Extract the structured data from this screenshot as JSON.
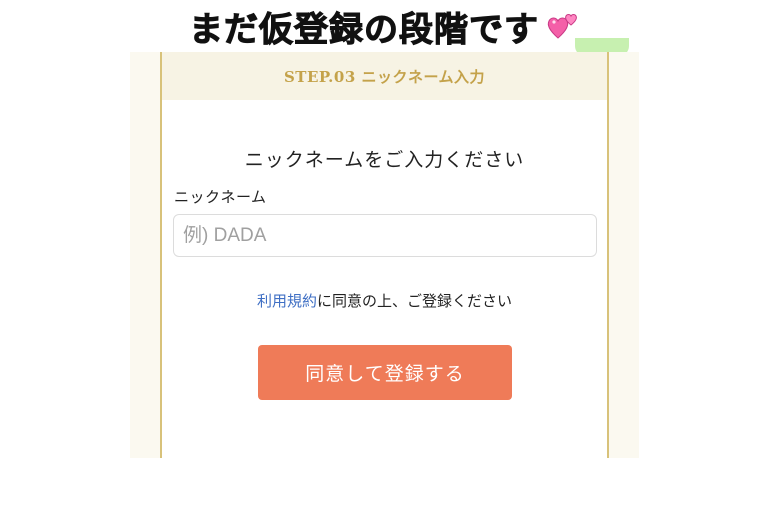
{
  "caption": {
    "text": "まだ仮登録の段階です",
    "emoji_icon": "two-hearts-icon"
  },
  "step": {
    "title": "STEP.03 ニックネーム入力"
  },
  "form": {
    "heading": "ニックネームをご入力ください",
    "field_label": "ニックネーム",
    "nickname_value": "",
    "nickname_placeholder": "例) DADA",
    "terms_link": "利用規約",
    "consent_text": "に同意の上、ご登録ください",
    "submit_label": "同意して登録する"
  },
  "colors": {
    "accent_gold": "#c4a24a",
    "button_orange": "#ef7b58",
    "link_blue": "#3f6fc4",
    "frame_cream": "#fbf9f0"
  }
}
